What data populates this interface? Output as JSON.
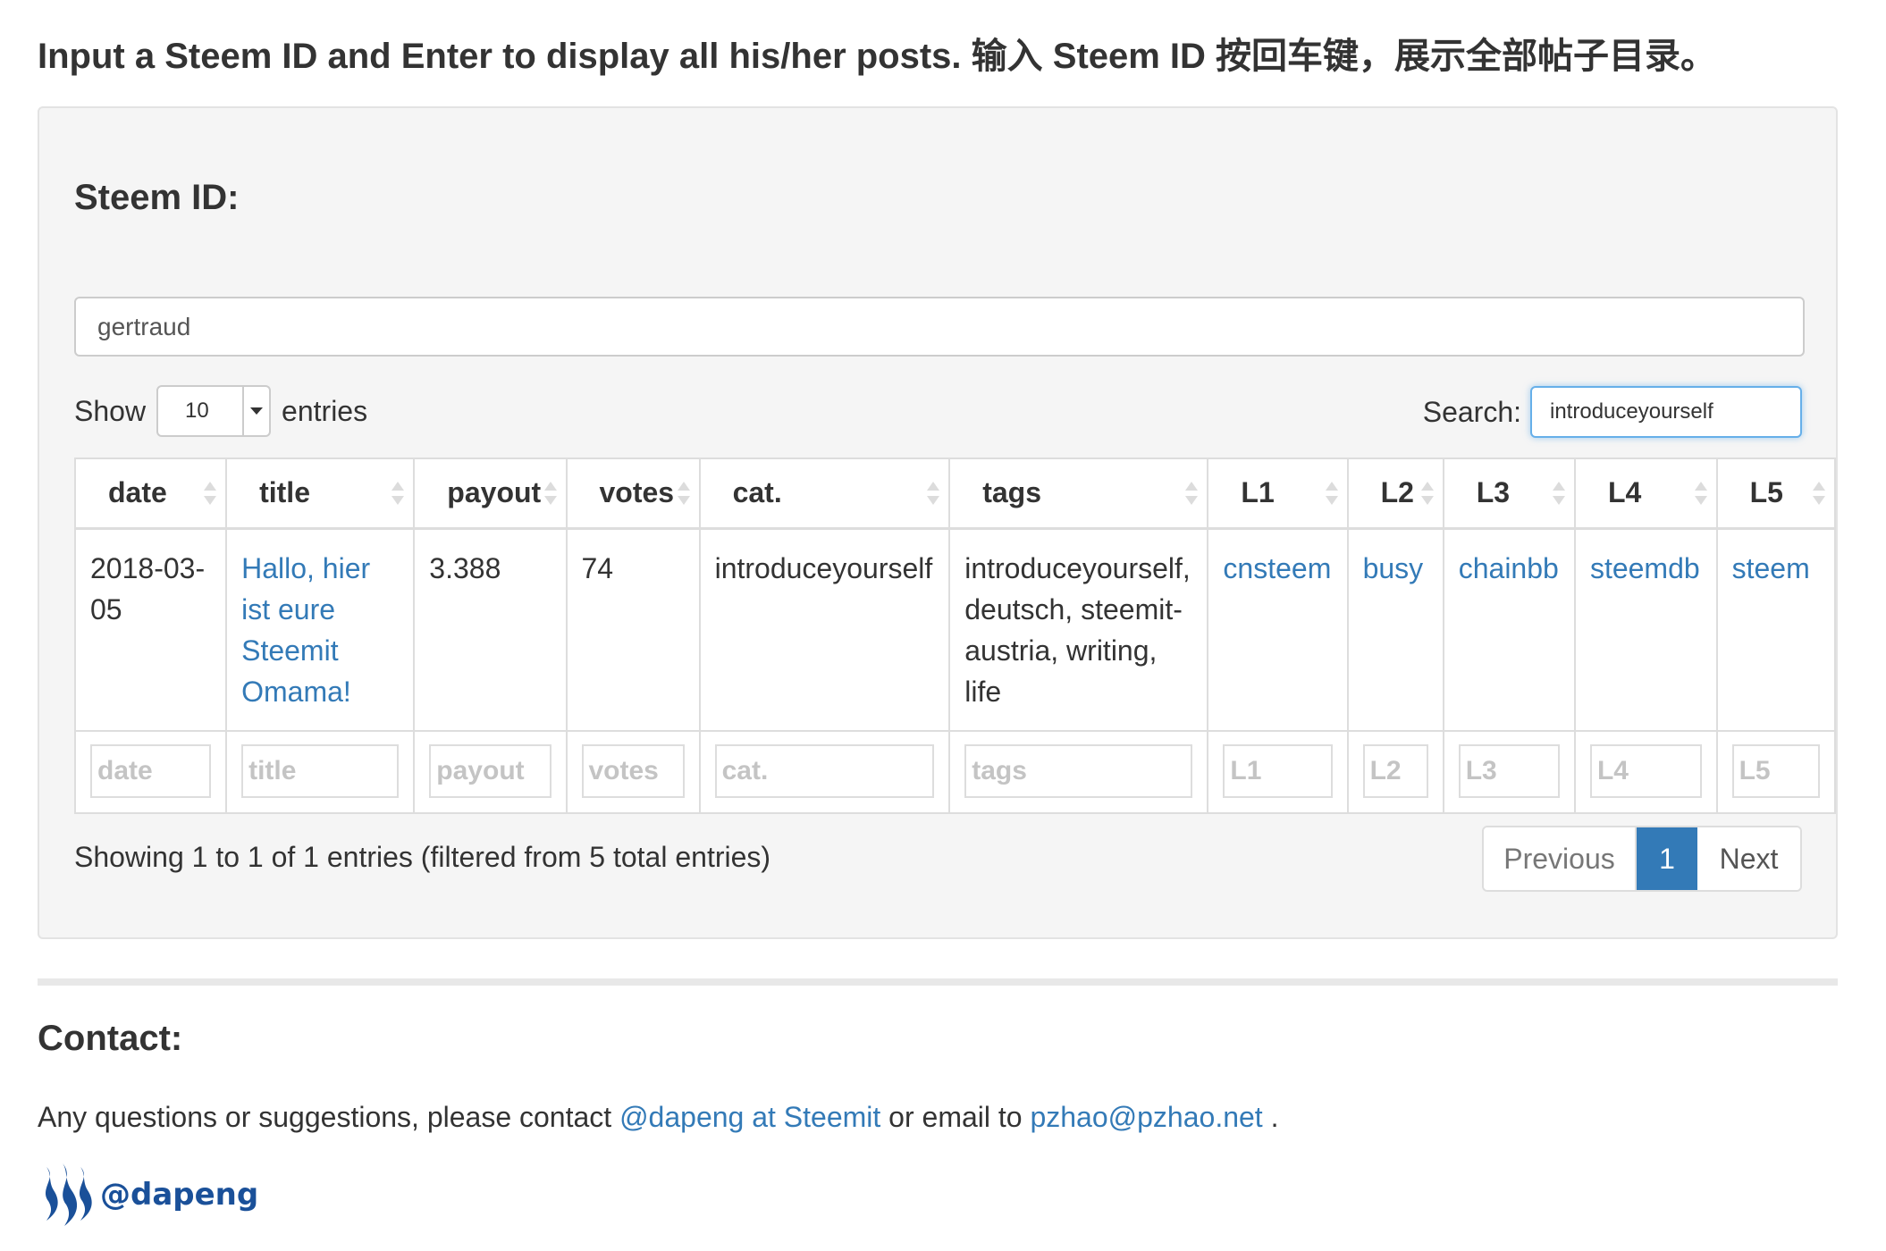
{
  "header": {
    "instruction": "Input a Steem ID and Enter to display all his/her posts. 输入 Steem ID 按回车键，展示全部帖子目录。"
  },
  "form": {
    "label": "Steem ID:",
    "steem_id_value": "gertraud"
  },
  "table_controls": {
    "show_label": "Show",
    "page_length": "10",
    "entries_label": "entries",
    "search_label": "Search:",
    "search_value": "introduceyourself"
  },
  "table": {
    "columns": [
      "date",
      "title",
      "payout",
      "votes",
      "cat.",
      "tags",
      "L1",
      "L2",
      "L3",
      "L4",
      "L5"
    ],
    "rows": [
      {
        "date": "2018-03-05",
        "title": "Hallo, hier ist eure Steemit Omama!",
        "payout": "3.388",
        "votes": "74",
        "cat": "introduceyourself",
        "tags": "introduceyourself, deutsch, steemit-austria, writing, life",
        "L1": "cnsteem",
        "L2": "busy",
        "L3": "chainbb",
        "L4": "steemdb",
        "L5": "steem"
      }
    ],
    "filter_placeholders": [
      "date",
      "title",
      "payout",
      "votes",
      "cat.",
      "tags",
      "L1",
      "L2",
      "L3",
      "L4",
      "L5"
    ]
  },
  "footer_info": {
    "summary": "Showing 1 to 1 of 1 entries (filtered from 5 total entries)"
  },
  "pagination": {
    "previous": "Previous",
    "current": "1",
    "next": "Next"
  },
  "contact": {
    "title": "Contact:",
    "text_before": "Any questions or suggestions, please contact ",
    "steemit_link": "@dapeng at Steemit",
    "text_middle": " or email to ",
    "email_link": "pzhao@pzhao.net",
    "text_after": " ."
  },
  "brand": {
    "icon": "steem-logo-icon",
    "handle": "@dapeng"
  },
  "colors": {
    "link": "#337ab7",
    "panel_bg": "#f5f5f5",
    "active_page": "#337ab7",
    "focus_border": "#66afe9",
    "brand": "#1a5099"
  }
}
